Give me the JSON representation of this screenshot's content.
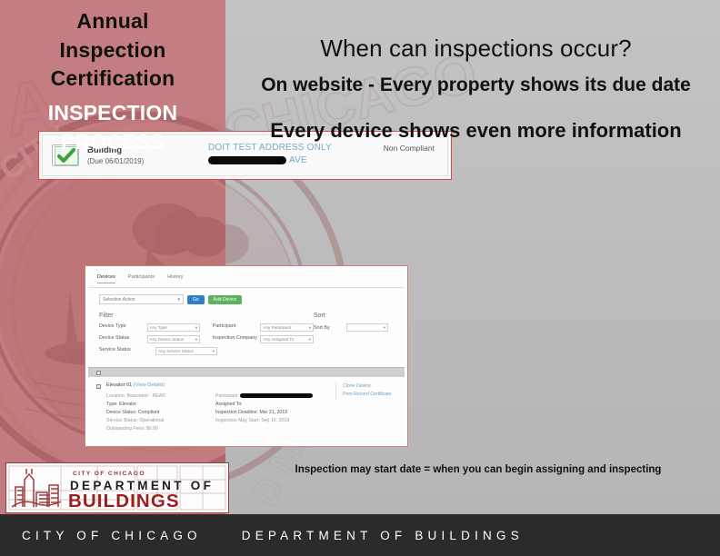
{
  "slide": {
    "left_panel": {
      "title_lines": [
        "Annual",
        "Inspection",
        "Certification"
      ],
      "subtitle_lines": [
        "INSPECTION",
        "PROCESS"
      ],
      "seal_text": "CITY OF CHICAGO INCORPORATED"
    },
    "headings": {
      "question": "When can inspections occur?",
      "subhead": "On website - Every property shows its due date",
      "midhead": "Every device shows even more information"
    },
    "caption": "Inspection may start date = when you can begin assigning and inspecting"
  },
  "screenshot_building": {
    "icon": "green-check-icon",
    "record_type": "Building",
    "due_text": "(Due 06/01/2019)",
    "address_line1": "DOIT TEST ADDRESS ONLY",
    "address_line2_suffix": "AVE",
    "address_redacted": true,
    "status": "Non Compliant"
  },
  "screenshot_devices": {
    "tabs": [
      {
        "label": "Devices",
        "active": true
      },
      {
        "label": "Participants",
        "active": false
      },
      {
        "label": "History",
        "active": false
      }
    ],
    "action_select": "Selection Action",
    "go_button": "Go",
    "add_device_button": "Add Device",
    "filter": {
      "title": "Filter",
      "rows": [
        {
          "label": "Device Type",
          "value": "Any Type"
        },
        {
          "label": "Device Status",
          "value": "Any Device Status"
        },
        {
          "label": "Service Status",
          "value": "Any Service Status"
        }
      ],
      "rows_right": [
        {
          "label": "Participant",
          "value": "Any Participant"
        },
        {
          "label": "Inspection Company",
          "value": "Any Assigned To"
        }
      ]
    },
    "sort": {
      "title": "Sort",
      "label": "Sort By",
      "value": ""
    },
    "device": {
      "name": "Elevator 01",
      "view_details": "(View Details)",
      "fields_left": [
        "Location: Basement - REAR",
        "Type: Elevator",
        "Device Status: Compliant",
        "Service Status: Operational",
        "Outstanding Fees: $0.00"
      ],
      "fields_right": [
        {
          "label": "Participant:",
          "redacted": true
        },
        {
          "label": "Assigned To:",
          "value": ""
        },
        {
          "label": "Inspection Deadline:",
          "value": "Mar 21, 2019"
        },
        {
          "label": "Inspection May Start:",
          "value": "Sep 15, 2018"
        }
      ],
      "side_links": [
        "Clone Device",
        "Print Record Certificate"
      ]
    }
  },
  "logo": {
    "line1": "CITY OF CHICAGO",
    "line2": "DEPARTMENT OF",
    "line3": "BUILDINGS"
  },
  "footer": {
    "city": "CITY OF CHICAGO",
    "dept": "DEPARTMENT OF BUILDINGS"
  },
  "colors": {
    "panel_rose": "#c47477",
    "accent_red": "#9a3c3c",
    "footer_bg": "#2b2b2b",
    "go_blue": "#2f7fc4",
    "add_green": "#5cb35c",
    "link_blue": "#6f9dc0",
    "frame_red": "#d44b4b"
  }
}
